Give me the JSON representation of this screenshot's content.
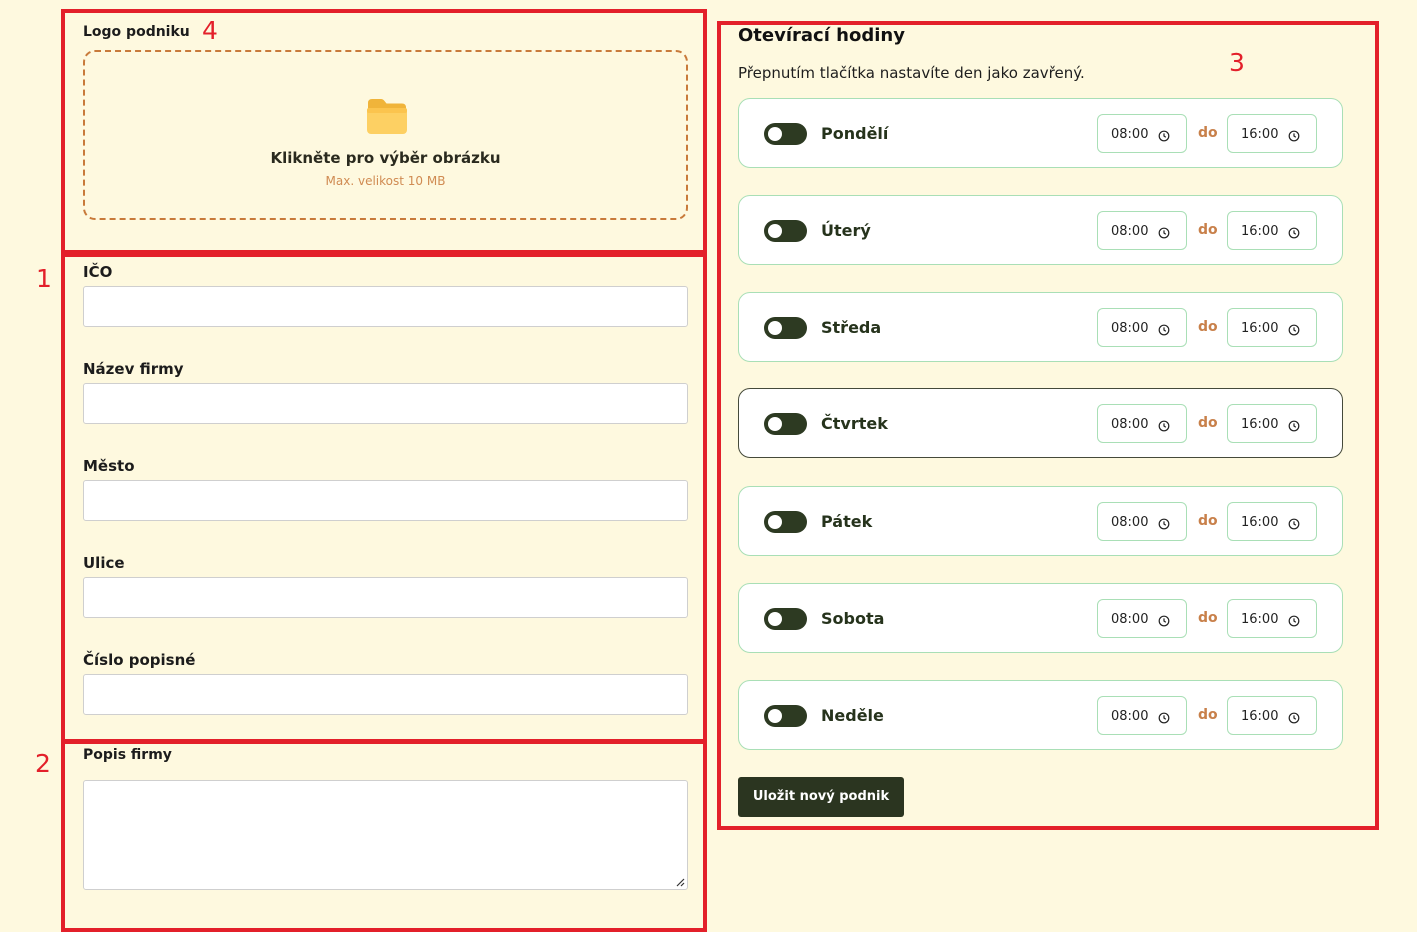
{
  "annotations": [
    "4",
    "1",
    "2",
    "3"
  ],
  "logo": {
    "label": "Logo podniku",
    "dropzone_title": "Klikněte pro výběr obrázku",
    "dropzone_hint": "Max. velikost 10 MB",
    "icon": "folder-icon"
  },
  "company": {
    "fields": [
      {
        "label": "IČO",
        "value": ""
      },
      {
        "label": "Název firmy",
        "value": ""
      },
      {
        "label": "Město",
        "value": ""
      },
      {
        "label": "Ulice",
        "value": ""
      },
      {
        "label": "Číslo popisné",
        "value": ""
      }
    ]
  },
  "description": {
    "label": "Popis firmy",
    "value": ""
  },
  "hours": {
    "title": "Otevírací hodiny",
    "description": "Přepnutím tlačítka nastavíte den jako zavřený.",
    "separator": "do",
    "days": [
      {
        "name": "Pondělí",
        "from": "08:00",
        "to": "16:00"
      },
      {
        "name": "Úterý",
        "from": "08:00",
        "to": "16:00"
      },
      {
        "name": "Středa",
        "from": "08:00",
        "to": "16:00"
      },
      {
        "name": "Čtvrtek",
        "from": "08:00",
        "to": "16:00"
      },
      {
        "name": "Pátek",
        "from": "08:00",
        "to": "16:00"
      },
      {
        "name": "Sobota",
        "from": "08:00",
        "to": "16:00"
      },
      {
        "name": "Neděle",
        "from": "08:00",
        "to": "16:00"
      }
    ]
  },
  "save_button": "Uložit nový podnik",
  "colors": {
    "background": "#fef9df",
    "annotation_red": "#e3202a",
    "toggle_dark": "#2d3a22",
    "row_border": "#a9dfb6",
    "accent_orange": "#c8804a",
    "button_dark": "#2b3520"
  }
}
